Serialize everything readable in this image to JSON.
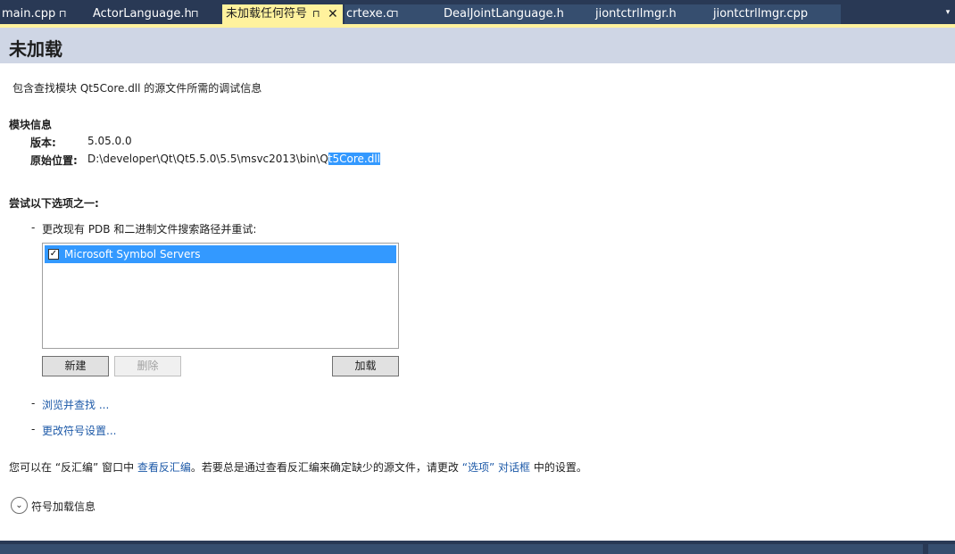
{
  "tabs": [
    {
      "label": "main.cpp",
      "pin": "⊓"
    },
    {
      "label": "ActorLanguage.h",
      "pin": "⊓"
    },
    {
      "label": "未加载任何符号",
      "pin": "⊓",
      "close": "✕"
    },
    {
      "label": "crtexe.c",
      "pin": "⊓"
    },
    {
      "label": "DealJointLanguage.h"
    },
    {
      "label": "jiontctrllmgr.h"
    },
    {
      "label": "jiontctrllmgr.cpp"
    }
  ],
  "dropdown_icon": "▾",
  "header": {
    "title": "未加载"
  },
  "description": "包含查找模块 Qt5Core.dll 的源文件所需的调试信息",
  "module_info": {
    "heading": "模块信息",
    "version_label": "版本:",
    "version_value": "5.05.0.0",
    "location_label": "原始位置:",
    "location_prefix": "D:\\developer\\Qt\\Qt5.5.0\\5.5\\msvc2013\\bin\\Q",
    "location_selected": "t5Core.dll"
  },
  "options": {
    "heading": "尝试以下选项之一:",
    "bullet": "-",
    "item1": "更改现有 PDB 和二进制文件搜索路径并重试:",
    "list_items": [
      {
        "label": "Microsoft Symbol Servers",
        "checked": true
      }
    ],
    "check_mark": "✓",
    "new_button": "新建",
    "delete_button": "删除",
    "load_button": "加载",
    "browse_link": "浏览并查找 ...",
    "symbol_settings_link": "更改符号设置..."
  },
  "footer_text": {
    "part1": "您可以在 “反汇编” 窗口中",
    "link1": "查看反汇编",
    "part2": "。若要总是通过查看反汇编来确定缺少的源文件，请更改",
    "link2": "“选项” 对话框",
    "part3": "中的设置。"
  },
  "expander": {
    "icon": "⌄",
    "label": "符号加载信息"
  },
  "colors": {
    "tab_strip": "#293955",
    "active_tab": "#fff29d",
    "header": "#cfd6e5",
    "selection": "#3399ff",
    "link": "#1e5aa8"
  }
}
